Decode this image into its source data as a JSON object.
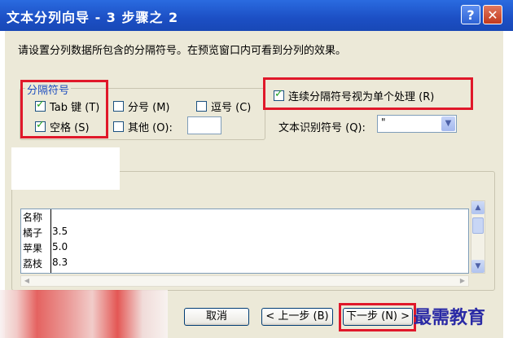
{
  "window": {
    "title": "文本分列向导 - 3 步骤之 2",
    "help": "?",
    "close": "✕"
  },
  "instruction": "请设置分列数据所包含的分隔符号。在预览窗口内可看到分列的效果。",
  "delimiters": {
    "legend": "分隔符号",
    "tab": "Tab 键 (T)",
    "semicolon": "分号 (M)",
    "comma": "逗号 (C)",
    "space": "空格 (S)",
    "other": "其他 (O):",
    "other_value": ""
  },
  "consecutive_label": "连续分隔符号视为单个处理 (R)",
  "text_qualifier": {
    "label": "文本识别符号 (Q):",
    "value": "\""
  },
  "preview": {
    "rows": [
      {
        "c1": "名称",
        "c2": ""
      },
      {
        "c1": "橘子",
        "c2": "3.5"
      },
      {
        "c1": "苹果",
        "c2": "5.0"
      },
      {
        "c1": "荔枝",
        "c2": "8.3"
      }
    ]
  },
  "buttons": {
    "cancel": "取消",
    "back": "< 上一步 (B)",
    "next": "下一步 (N) >"
  },
  "watermark": "最需教育",
  "colors": {
    "title_bar": "#1c4fc4",
    "highlight_box": "#e0182a",
    "dialog_bg": "#ece9d8"
  }
}
